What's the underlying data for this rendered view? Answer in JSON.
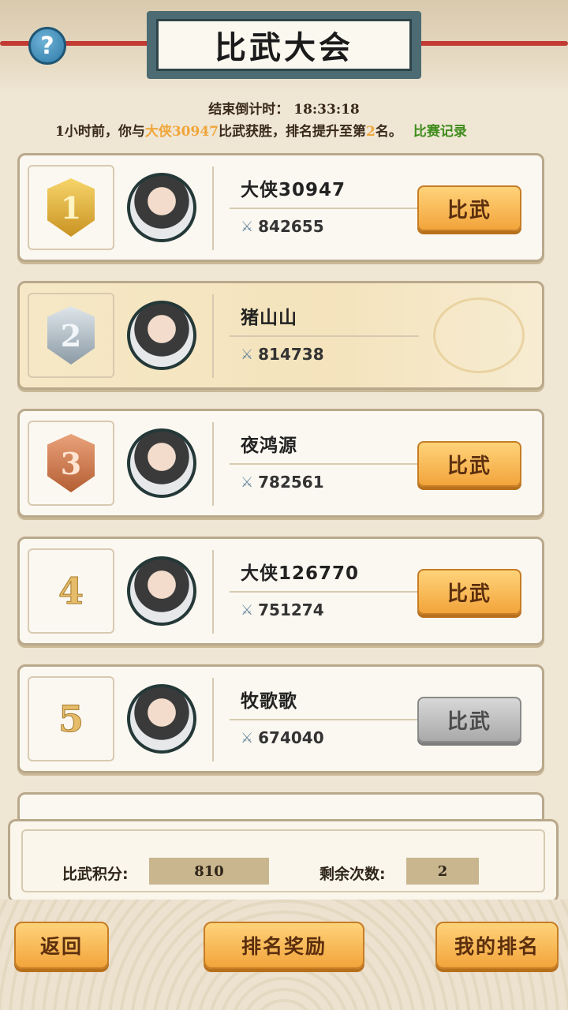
{
  "header": {
    "help_label": "?",
    "title": "比武大会"
  },
  "countdown": {
    "label": "结束倒计时：",
    "time": "18:33:18"
  },
  "news": {
    "prefix": "1小时前，你与",
    "opponent": "大侠30947",
    "mid": "比武获胜，排名提升至第",
    "rank": "2",
    "suffix": "名。",
    "record_link": "比赛记录"
  },
  "players": [
    {
      "rank": "1",
      "name": "大侠30947",
      "power": "842655",
      "button": "比武",
      "button_state": "active"
    },
    {
      "rank": "2",
      "name": "猪山山",
      "power": "814738",
      "button": "",
      "button_state": "self"
    },
    {
      "rank": "3",
      "name": "夜鸿源",
      "power": "782561",
      "button": "比武",
      "button_state": "active"
    },
    {
      "rank": "4",
      "name": "大侠126770",
      "power": "751274",
      "button": "比武",
      "button_state": "active"
    },
    {
      "rank": "5",
      "name": "牧歌歌",
      "power": "674040",
      "button": "比武",
      "button_state": "disabled"
    }
  ],
  "stats": {
    "points_label": "比武积分:",
    "points_value": "810",
    "remaining_label": "剩余次数:",
    "remaining_value": "2"
  },
  "footer": {
    "back": "返回",
    "rewards": "排名奖励",
    "my_rank": "我的排名"
  },
  "colors": {
    "accent": "#f2a43b",
    "highlight_name": "#f0a63a",
    "link": "#3f8d1c",
    "plaque": "#4c6b72"
  }
}
